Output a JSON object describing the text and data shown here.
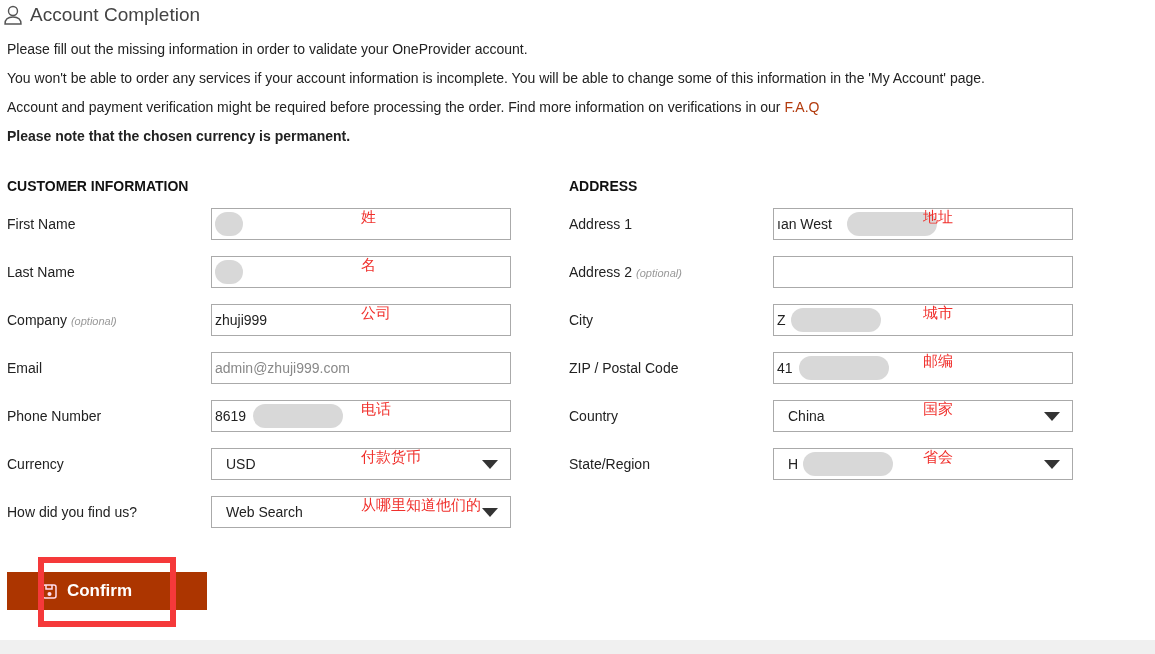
{
  "header": {
    "title": "Account Completion"
  },
  "intro": [
    "Please fill out the missing information in order to validate your OneProvider account.",
    "You won't be able to order any services if your account information is incomplete. You will be able to change some of this information in the 'My Account' page.",
    "Account and payment verification might be required before processing the order. Find more information on verifications in our "
  ],
  "faq_link": "F.A.Q",
  "notice": "Please note that the chosen currency is permanent.",
  "sections": [
    {
      "heading": "CUSTOMER INFORMATION",
      "fields": [
        {
          "kind": "text",
          "label": "First Name",
          "redacted": true,
          "note": "姓"
        },
        {
          "kind": "text",
          "label": "Last Name",
          "redacted": true,
          "note": "名"
        },
        {
          "kind": "text",
          "label": "Company",
          "optional": "(optional)",
          "value": "zhuji999",
          "note": "公司"
        },
        {
          "kind": "text",
          "label": "Email",
          "placeholder": "admin@zhuji999.com"
        },
        {
          "kind": "text",
          "label": "Phone Number",
          "value": "8619",
          "redacted": true,
          "note": "电话"
        },
        {
          "kind": "select",
          "label": "Currency",
          "value": "USD",
          "note": "付款货币"
        },
        {
          "kind": "select",
          "label": "How did you find us?",
          "value": "Web Search",
          "note": "从哪里知道他们的"
        }
      ]
    },
    {
      "heading": "ADDRESS",
      "fields": [
        {
          "kind": "text",
          "label": "Address 1",
          "value": "ıan West",
          "redacted": true,
          "note": "地址"
        },
        {
          "kind": "text",
          "label": "Address 2",
          "optional": "(optional)"
        },
        {
          "kind": "text",
          "label": "City",
          "value": "Z",
          "redacted": true,
          "note": "城市"
        },
        {
          "kind": "text",
          "label": "ZIP / Postal Code",
          "value": "41",
          "redacted": true,
          "note": "邮编"
        },
        {
          "kind": "select",
          "label": "Country",
          "value": "China",
          "note": "国家"
        },
        {
          "kind": "select",
          "label": "State/Region",
          "value": "H",
          "redacted": true,
          "note": "省会"
        }
      ]
    }
  ],
  "confirm": {
    "label": "Confirm",
    "highlighted": true
  }
}
